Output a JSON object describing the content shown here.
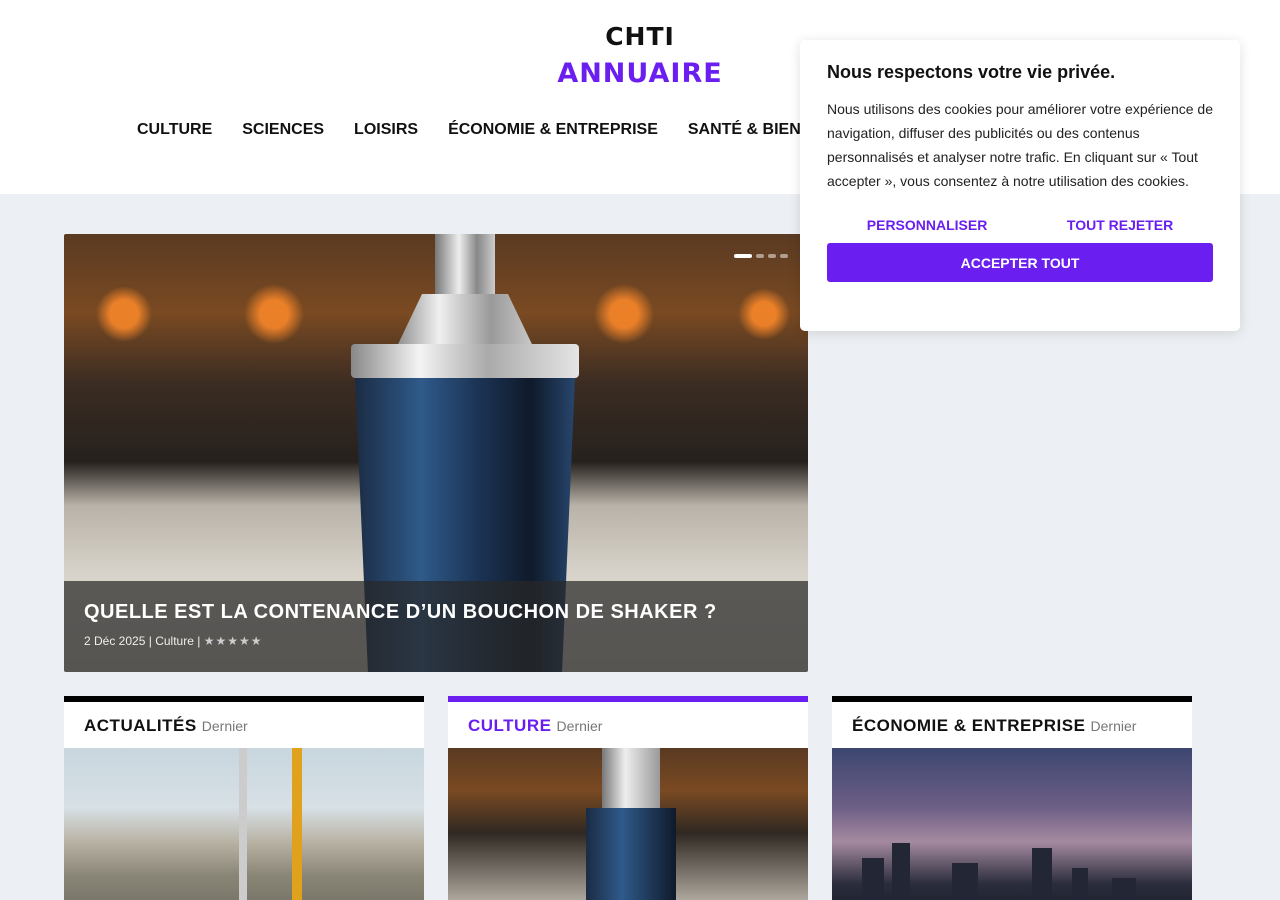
{
  "header": {
    "logo_top": "CHTI",
    "logo_bottom": "ANNUAIRE",
    "nav": [
      "CULTURE",
      "SCIENCES",
      "LOISIRS",
      "ÉCONOMIE & ENTREPRISE",
      "SANTÉ & BIEN-ÊTRE"
    ]
  },
  "hero": {
    "title": "QUELLE EST LA CONTENANCE D’UN BOUCHON DE SHAKER ?",
    "date": "2 Déc 2025",
    "separator": "|",
    "category": "Culture",
    "rating_stars": "★★★★★",
    "slides_total": 4,
    "slide_active": 1
  },
  "cards": [
    {
      "category": "ACTUALITÉS",
      "sub": "Dernier",
      "image": "construction-site"
    },
    {
      "category": "CULTURE",
      "sub": "Dernier",
      "image": "shaker"
    },
    {
      "category": "ÉCONOMIE & ENTREPRISE",
      "sub": "Dernier",
      "image": "city-skyline"
    }
  ],
  "cookie": {
    "title": "Nous respectons votre vie privée.",
    "text": "Nous utilisons des cookies pour améliorer votre expérience de navigation, diffuser des publicités ou des contenus personnalisés et analyser notre trafic. En cliquant sur « Tout accepter », vous consentez à notre utilisation des cookies.",
    "customize": "PERSONNALISER",
    "reject": "TOUT REJETER",
    "accept": "ACCEPTER TOUT"
  },
  "colors": {
    "accent": "#6a1ff0",
    "page_bg": "#eceff3"
  }
}
